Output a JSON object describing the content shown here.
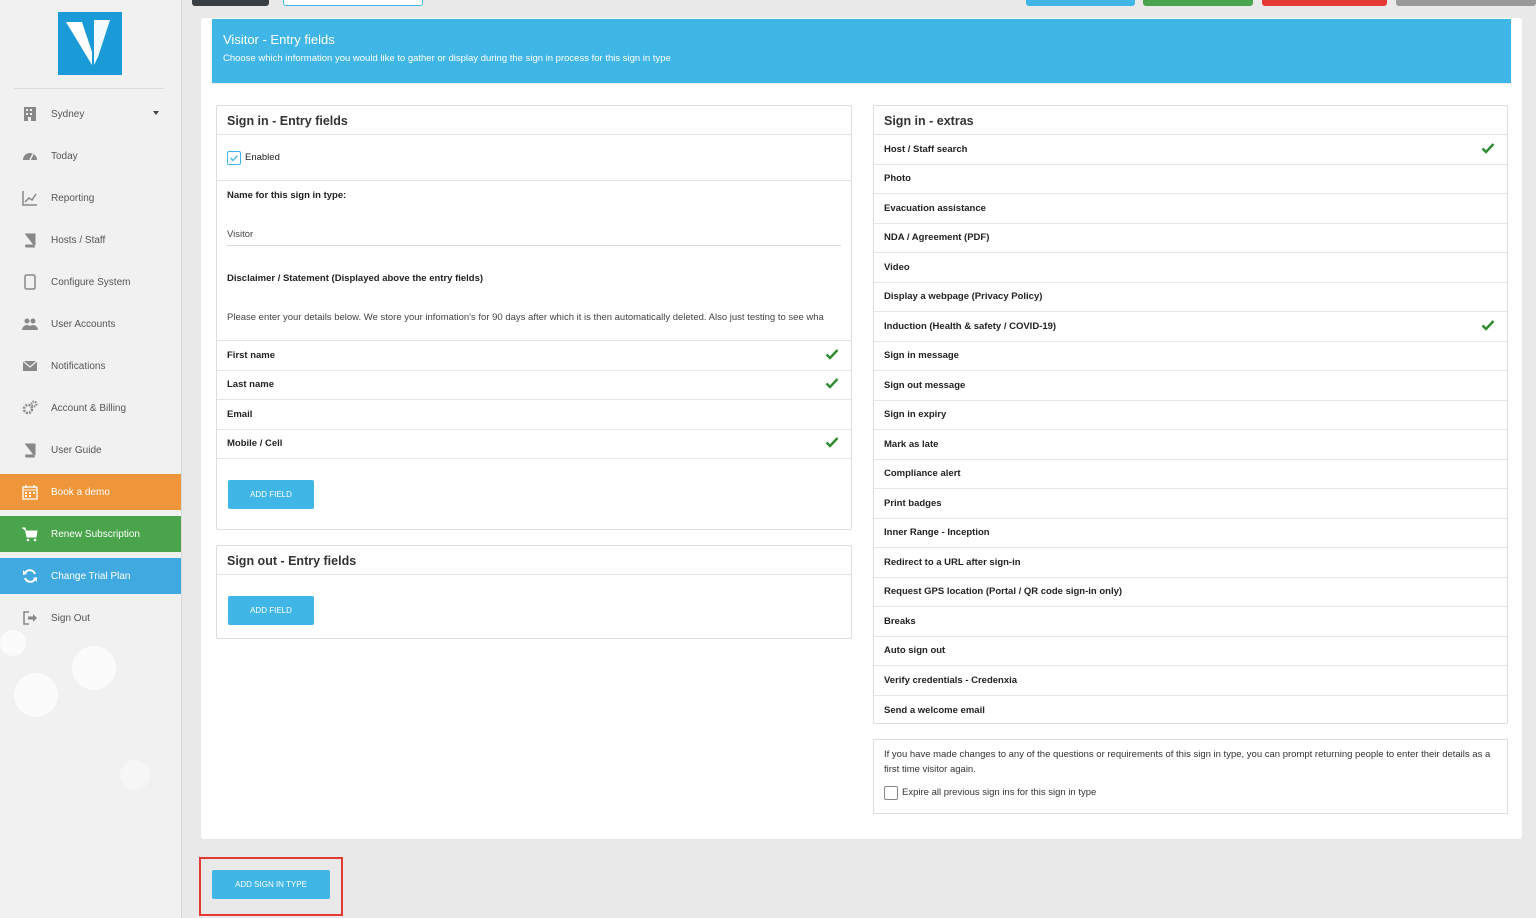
{
  "sidebar": {
    "location": "Sydney",
    "items": [
      {
        "label": "Today",
        "icon": "dashboard-icon"
      },
      {
        "label": "Reporting",
        "icon": "chart-icon"
      },
      {
        "label": "Hosts / Staff",
        "icon": "book-icon"
      },
      {
        "label": "Configure System",
        "icon": "tablet-icon"
      },
      {
        "label": "User Accounts",
        "icon": "users-icon"
      },
      {
        "label": "Notifications",
        "icon": "envelope-icon"
      },
      {
        "label": "Account & Billing",
        "icon": "gears-icon"
      },
      {
        "label": "User Guide",
        "icon": "book-icon"
      },
      {
        "label": "Book a demo",
        "icon": "calendar-icon"
      },
      {
        "label": "Renew Subscription",
        "icon": "cart-icon"
      },
      {
        "label": "Change Trial Plan",
        "icon": "refresh-icon"
      },
      {
        "label": "Sign Out",
        "icon": "sign-out-icon"
      }
    ]
  },
  "header": {
    "title": "Visitor - Entry fields",
    "subtitle": "Choose which information you would like to gather or display during the sign in process for this sign in type"
  },
  "signin_entry": {
    "title": "Sign in - Entry fields",
    "enabled_label": "Enabled",
    "name_label": "Name for this sign in type:",
    "name_value": "Visitor",
    "disclaimer_label": "Disclaimer / Statement (Displayed above the entry fields)",
    "disclaimer_value": "Please enter your details below. We store your infomation's for 90 days after which it is then automatically deleted. Also just testing to see wha",
    "fields": [
      {
        "label": "First name",
        "checked": true
      },
      {
        "label": "Last name",
        "checked": true
      },
      {
        "label": "Email",
        "checked": false
      },
      {
        "label": "Mobile / Cell",
        "checked": true
      }
    ],
    "add_field_label": "ADD FIELD"
  },
  "signout_entry": {
    "title": "Sign out - Entry fields",
    "add_field_label": "ADD FIELD"
  },
  "extras": {
    "title": "Sign in - extras",
    "items": [
      {
        "label": "Host / Staff search",
        "checked": true
      },
      {
        "label": "Photo",
        "checked": false
      },
      {
        "label": "Evacuation assistance",
        "checked": false
      },
      {
        "label": "NDA / Agreement (PDF)",
        "checked": false
      },
      {
        "label": "Video",
        "checked": false
      },
      {
        "label": "Display a webpage (Privacy Policy)",
        "checked": false
      },
      {
        "label": "Induction (Health & safety / COVID-19)",
        "checked": true
      },
      {
        "label": "Sign in message",
        "checked": false
      },
      {
        "label": "Sign out message",
        "checked": false
      },
      {
        "label": "Sign in expiry",
        "checked": false
      },
      {
        "label": "Mark as late",
        "checked": false
      },
      {
        "label": "Compliance alert",
        "checked": false
      },
      {
        "label": "Print badges",
        "checked": false
      },
      {
        "label": "Inner Range - Inception",
        "checked": false
      },
      {
        "label": "Redirect to a URL after sign-in",
        "checked": false
      },
      {
        "label": "Request GPS location (Portal / QR code sign-in only)",
        "checked": false
      },
      {
        "label": "Breaks",
        "checked": false
      },
      {
        "label": "Auto sign out",
        "checked": false
      },
      {
        "label": "Verify credentials - Credenxia",
        "checked": false
      },
      {
        "label": "Send a welcome email",
        "checked": false
      }
    ]
  },
  "note": {
    "text": "If you have made changes to any of the questions or requirements of this sign in type, you can prompt returning people to enter their details as a first time visitor again.",
    "expire_label": "Expire all previous sign ins for this sign in type"
  },
  "footer": {
    "add_sign_in_type_label": "ADD SIGN IN TYPE"
  },
  "colors": {
    "accent": "#3fb6e6",
    "check": "#2e8b2e",
    "orange": "#f0963a",
    "green": "#4aa44b",
    "highlight": "#e53935"
  }
}
